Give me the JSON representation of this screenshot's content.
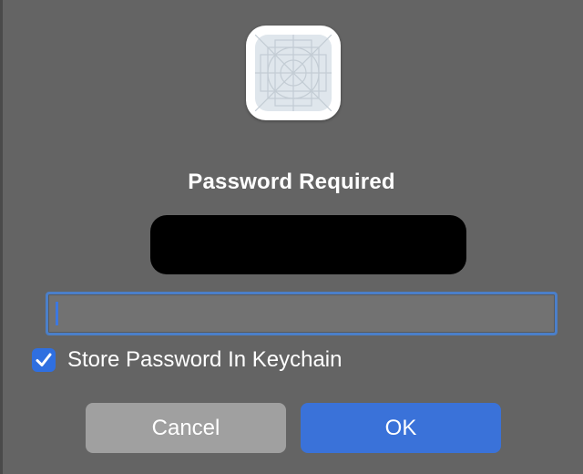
{
  "dialog": {
    "icon": "app-placeholder-icon",
    "title": "Password Required",
    "redacted_text": "",
    "password_field": {
      "value": "",
      "placeholder": ""
    },
    "store_in_keychain": {
      "label": "Store Password In Keychain",
      "checked": true
    },
    "buttons": {
      "cancel_label": "Cancel",
      "ok_label": "OK"
    }
  },
  "colors": {
    "background": "#646464",
    "accent": "#3a72d9",
    "checkbox": "#2f6fe0",
    "cancel_button": "#a0a0a0"
  }
}
